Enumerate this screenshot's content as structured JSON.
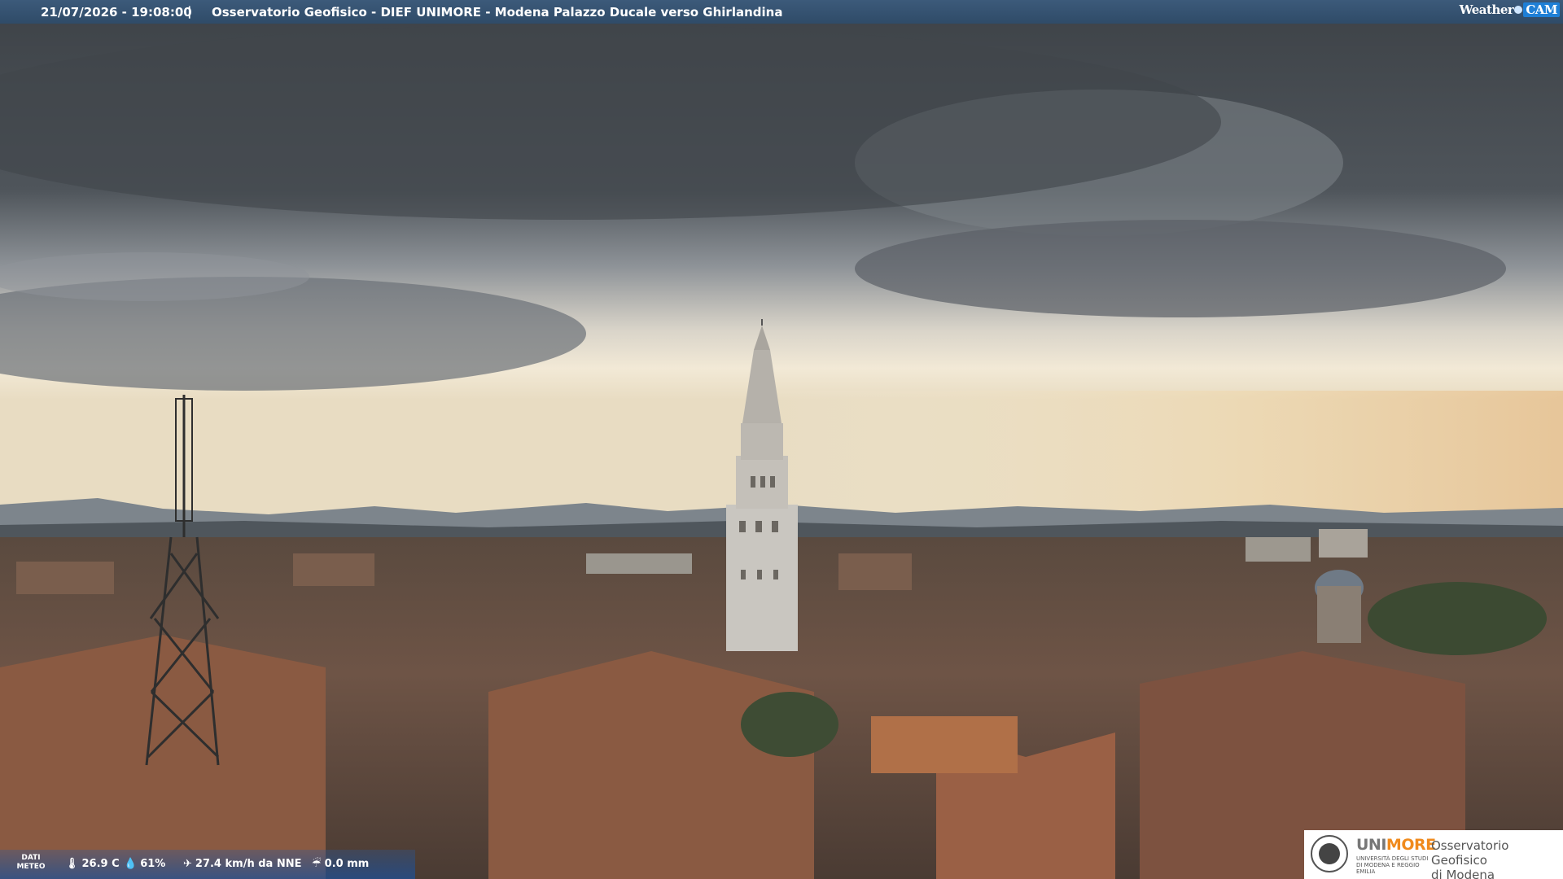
{
  "topbar": {
    "timestamp": "21/07/2026 - 19:08:00",
    "separator": "|",
    "camera_title": "Osservatorio Geofisico - DIEF UNIMORE - Modena Palazzo Ducale verso Ghirlandina",
    "provider_logo": {
      "part1": "Weather",
      "part2": "CAM"
    }
  },
  "weather_data": {
    "label_line1": "DATI",
    "label_line2": "METEO",
    "temperature": "26.9 C",
    "humidity": "61%",
    "wind": "27.4 km/h da NNE",
    "rain": "0.0 mm",
    "icons": [
      "thermometer-icon",
      "droplet-icon",
      "wind-icon",
      "rain-gauge-icon"
    ]
  },
  "logo_panel": {
    "university": {
      "part1": "UNI",
      "part2": "MORE"
    },
    "university_sub": "UNIVERSITÀ DEGLI STUDI DI MODENA E REGGIO EMILIA",
    "observatory_line1": "Osservatorio Geofisico",
    "observatory_line2": "di Modena"
  },
  "colors": {
    "accent_orange": "#f08a1c",
    "bar_blue": "#2f4b68",
    "brand_blue": "#1e7fd6"
  }
}
